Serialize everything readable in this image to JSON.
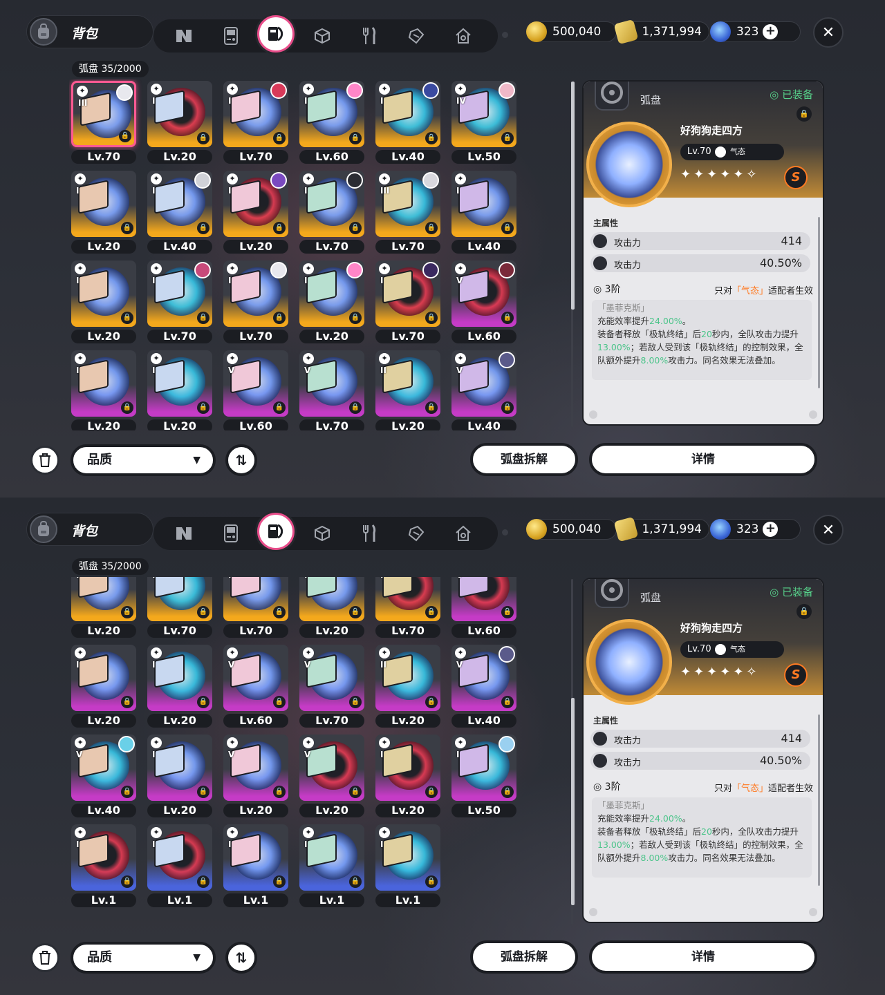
{
  "header": {
    "bag_title": "背包",
    "tabs": [
      {
        "icon": "n-logo-icon"
      },
      {
        "icon": "gameboy-icon"
      },
      {
        "icon": "disc-case-icon",
        "active": true
      },
      {
        "icon": "cube-icon"
      },
      {
        "icon": "fork-knife-icon"
      },
      {
        "icon": "box-tag-icon"
      },
      {
        "icon": "house-icon"
      }
    ],
    "currencies": [
      {
        "icon": "coin-icon",
        "value": "500,040"
      },
      {
        "icon": "ticket-icon",
        "value": "1,371,994"
      },
      {
        "icon": "gem-icon",
        "value": "323"
      }
    ],
    "close_label": "✕"
  },
  "inventory": {
    "category": "弧盘",
    "count": "35/2000"
  },
  "colors": {
    "accent": "#e84d8a",
    "gold": "#f4a81c",
    "purple": "#c53bc6",
    "blue": "#4a64dc",
    "equipped": "#57d18a",
    "highlight": "#ff7a22"
  },
  "panel1_cards": [
    {
      "rank": "III",
      "level": "Lv.70",
      "rarity": "gold",
      "disc": "blue",
      "selected": true,
      "avatar": "#e8e8ee"
    },
    {
      "rank": "I",
      "level": "Lv.20",
      "rarity": "gold",
      "disc": "red",
      "avatar": null
    },
    {
      "rank": "I",
      "level": "Lv.70",
      "rarity": "gold",
      "disc": "blue",
      "avatar": "#d83a5a"
    },
    {
      "rank": "I",
      "level": "Lv.60",
      "rarity": "gold",
      "disc": "blue",
      "avatar": "#ff86c8"
    },
    {
      "rank": "I",
      "level": "Lv.40",
      "rarity": "gold",
      "disc": "cyan",
      "avatar": "#3a4aa0"
    },
    {
      "rank": "IV",
      "level": "Lv.50",
      "rarity": "gold",
      "disc": "cyan",
      "avatar": "#f0b8c8"
    },
    {
      "rank": "I",
      "level": "Lv.20",
      "rarity": "gold",
      "disc": "blue",
      "avatar": null
    },
    {
      "rank": "I",
      "level": "Lv.40",
      "rarity": "gold",
      "disc": "blue",
      "avatar": "#d0d2d8"
    },
    {
      "rank": "I",
      "level": "Lv.20",
      "rarity": "gold",
      "disc": "red",
      "avatar": "#7a4ac0"
    },
    {
      "rank": "I",
      "level": "Lv.70",
      "rarity": "gold",
      "disc": "blue",
      "avatar": "#2a2c33"
    },
    {
      "rank": "III",
      "level": "Lv.70",
      "rarity": "gold",
      "disc": "cyan",
      "avatar": "#d8d8de"
    },
    {
      "rank": "I",
      "level": "Lv.40",
      "rarity": "gold",
      "disc": "blue",
      "avatar": null
    },
    {
      "rank": "I",
      "level": "Lv.20",
      "rarity": "gold",
      "disc": "blue",
      "avatar": null
    },
    {
      "rank": "I",
      "level": "Lv.70",
      "rarity": "gold",
      "disc": "cyan",
      "avatar": "#c84a7a"
    },
    {
      "rank": "I",
      "level": "Lv.70",
      "rarity": "gold",
      "disc": "blue",
      "avatar": "#e8e8ee"
    },
    {
      "rank": "I",
      "level": "Lv.20",
      "rarity": "gold",
      "disc": "blue",
      "avatar": "#ff86c8"
    },
    {
      "rank": "I",
      "level": "Lv.70",
      "rarity": "gold",
      "disc": "red",
      "avatar": "#3a2a60"
    },
    {
      "rank": "V",
      "level": "Lv.60",
      "rarity": "purple",
      "disc": "red",
      "avatar": "#7a2a3a"
    },
    {
      "rank": "I",
      "level": "Lv.20",
      "rarity": "purple",
      "disc": "blue",
      "avatar": null
    },
    {
      "rank": "I",
      "level": "Lv.20",
      "rarity": "purple",
      "disc": "cyan",
      "avatar": null
    },
    {
      "rank": "V",
      "level": "Lv.60",
      "rarity": "purple",
      "disc": "blue",
      "avatar": null
    },
    {
      "rank": "V",
      "level": "Lv.70",
      "rarity": "purple",
      "disc": "blue",
      "avatar": null
    },
    {
      "rank": "II",
      "level": "Lv.20",
      "rarity": "purple",
      "disc": "cyan",
      "avatar": null
    },
    {
      "rank": "V",
      "level": "Lv.40",
      "rarity": "purple",
      "disc": "blue",
      "avatar": "#5a5a8a"
    }
  ],
  "panel2_cards": [
    {
      "rank": "I",
      "level": "Lv.20",
      "rarity": "gold",
      "disc": "blue",
      "avatar": null
    },
    {
      "rank": "I",
      "level": "Lv.70",
      "rarity": "gold",
      "disc": "cyan",
      "avatar": "#c84a7a"
    },
    {
      "rank": "I",
      "level": "Lv.70",
      "rarity": "gold",
      "disc": "blue",
      "avatar": "#e8e8ee"
    },
    {
      "rank": "I",
      "level": "Lv.20",
      "rarity": "gold",
      "disc": "blue",
      "avatar": "#ff86c8"
    },
    {
      "rank": "I",
      "level": "Lv.70",
      "rarity": "gold",
      "disc": "red",
      "avatar": "#3a2a60"
    },
    {
      "rank": "V",
      "level": "Lv.60",
      "rarity": "purple",
      "disc": "red",
      "avatar": "#7a2a3a"
    },
    {
      "rank": "I",
      "level": "Lv.20",
      "rarity": "purple",
      "disc": "blue",
      "avatar": null
    },
    {
      "rank": "I",
      "level": "Lv.20",
      "rarity": "purple",
      "disc": "cyan",
      "avatar": null
    },
    {
      "rank": "V",
      "level": "Lv.60",
      "rarity": "purple",
      "disc": "blue",
      "avatar": null
    },
    {
      "rank": "V",
      "level": "Lv.70",
      "rarity": "purple",
      "disc": "blue",
      "avatar": null
    },
    {
      "rank": "II",
      "level": "Lv.20",
      "rarity": "purple",
      "disc": "cyan",
      "avatar": null
    },
    {
      "rank": "V",
      "level": "Lv.40",
      "rarity": "purple",
      "disc": "blue",
      "avatar": "#5a5a8a"
    },
    {
      "rank": "V",
      "level": "Lv.40",
      "rarity": "purple",
      "disc": "cyan",
      "avatar": "#6ad0e8"
    },
    {
      "rank": "I",
      "level": "Lv.20",
      "rarity": "purple",
      "disc": "blue",
      "avatar": null
    },
    {
      "rank": "V",
      "level": "Lv.20",
      "rarity": "purple",
      "disc": "blue",
      "avatar": null
    },
    {
      "rank": "V",
      "level": "Lv.20",
      "rarity": "purple",
      "disc": "red",
      "avatar": null
    },
    {
      "rank": "I",
      "level": "Lv.20",
      "rarity": "purple",
      "disc": "red",
      "avatar": null
    },
    {
      "rank": "I",
      "level": "Lv.50",
      "rarity": "purple",
      "disc": "cyan",
      "avatar": "#9ad0f0"
    },
    {
      "rank": "I",
      "level": "Lv.1",
      "rarity": "blue",
      "disc": "red",
      "avatar": null
    },
    {
      "rank": "I",
      "level": "Lv.1",
      "rarity": "blue",
      "disc": "red",
      "avatar": null
    },
    {
      "rank": "I",
      "level": "Lv.1",
      "rarity": "blue",
      "disc": "blue",
      "avatar": null
    },
    {
      "rank": "I",
      "level": "Lv.1",
      "rarity": "blue",
      "disc": "blue",
      "avatar": null
    },
    {
      "rank": "I",
      "level": "Lv.1",
      "rarity": "blue",
      "disc": "cyan",
      "avatar": null
    }
  ],
  "detail": {
    "category": "弧盘",
    "equipped": "◎ 已装备",
    "name": "好狗狗走四方",
    "level": "Lv.70",
    "style": "气态",
    "stars": "✦✦✦✦✦✧",
    "rank_badge": "S",
    "main_attr_label": "主属性",
    "stats": [
      {
        "label": "攻击力",
        "value": "414"
      },
      {
        "label": "攻击力",
        "value": "40.50%"
      }
    ],
    "phase": "◎ 3阶",
    "only_prefix": "只对",
    "only_hl": "「气态」",
    "only_suffix": "适配者生效",
    "desc_quote": "「墨菲克斯」",
    "desc1a": "充能效率提升",
    "desc1b": "24.00%",
    "desc1c": "。",
    "desc2a": "装备者释放「极轨终结」后",
    "desc2b": "20",
    "desc2c": "秒内，全队攻击力提升",
    "desc2d": "13.00%",
    "desc2e": "；若敌人受到该「极轨终结」的控制效果，全队额外提升",
    "desc2f": "8.00%",
    "desc2g": "攻击力。同名效果无法叠加。"
  },
  "footer": {
    "quality_label": "品质",
    "disassemble_label": "弧盘拆解",
    "detail_label": "详情"
  }
}
